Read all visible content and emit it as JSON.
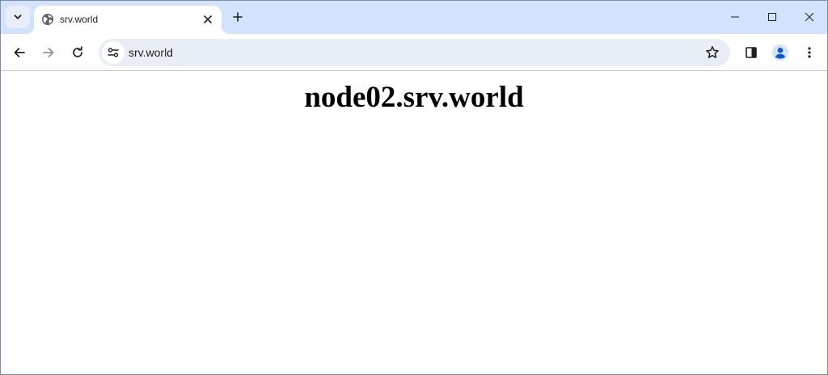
{
  "browser": {
    "tab": {
      "title": "srv.world",
      "favicon": "globe-icon"
    },
    "address_bar": {
      "url": "srv.world"
    },
    "icons": {
      "tab_search": "chevron-down-icon",
      "tab_close": "close-icon",
      "new_tab": "plus-icon",
      "minimize": "minimize-icon",
      "maximize": "maximize-icon",
      "close_window": "close-icon",
      "back": "arrow-left-icon",
      "forward": "arrow-right-icon",
      "reload": "reload-icon",
      "site_info": "tune-icon",
      "bookmark": "star-icon",
      "side_panel": "side-panel-icon",
      "profile": "profile-icon",
      "menu": "kebab-menu-icon"
    },
    "colors": {
      "tab_strip": "#d3e3fd",
      "omnibox": "#e9eef6",
      "profile_accent": "#0b57d0"
    }
  },
  "page": {
    "heading": "node02.srv.world"
  }
}
